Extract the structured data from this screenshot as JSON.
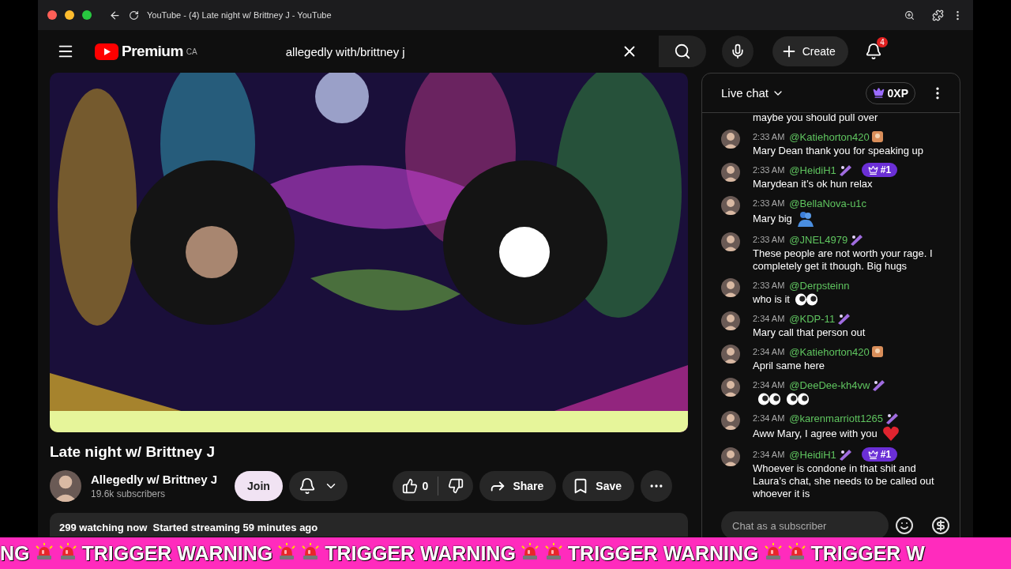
{
  "browser": {
    "tab_title": "YouTube - (4) Late night w/ Brittney J - YouTube"
  },
  "header": {
    "logo": "Premium",
    "region": "CA",
    "search": {
      "value": "allegedly with/brittney j"
    },
    "create": "Create",
    "notifications": "4"
  },
  "video": {
    "kind": "picture",
    "title": "Late night w/ Brittney J",
    "channel": "Allegedly w/ Brittney J",
    "subscribers": "19.6k subscribers",
    "join": "Join",
    "likes": "0",
    "share": "Share",
    "save": "Save",
    "description": "299 watching now  Started streaming 59 minutes ago"
  },
  "chat": {
    "title": "Live chat",
    "xp": "0XP",
    "messages": [
      {
        "kind": "tail",
        "text": "maybe you should pull over"
      },
      {
        "kind": "message",
        "time": "2:33 AM",
        "author": "@Katiehorton420",
        "badge": {
          "kind": "tile"
        },
        "text": "Mary Dean thank you for speaking up"
      },
      {
        "kind": "message",
        "time": "2:33 AM",
        "author": "@HeidiH1",
        "badge": {
          "kind": "sparkle"
        },
        "rank": "#1",
        "text": "Marydean it’s ok hun relax"
      },
      {
        "kind": "message",
        "time": "2:33 AM",
        "author": "@BellaNova-u1c",
        "text": "Mary big",
        "icons": [
          {
            "kind": "hug"
          }
        ]
      },
      {
        "kind": "message",
        "time": "2:33 AM",
        "author": "@JNEL4979",
        "badge": {
          "kind": "sparkle"
        },
        "text": "These people are not worth your rage. I completely get it though. Big hugs"
      },
      {
        "kind": "message",
        "time": "2:33 AM",
        "author": "@Derpsteinn",
        "text": "who is it",
        "icons": [
          {
            "kind": "eyes"
          }
        ]
      },
      {
        "kind": "message",
        "time": "2:34 AM",
        "author": "@KDP-11",
        "badge": {
          "kind": "sparkle"
        },
        "text": "Mary call that person out"
      },
      {
        "kind": "message",
        "time": "2:34 AM",
        "author": "@Katiehorton420",
        "badge": {
          "kind": "tile"
        },
        "text": "April same here"
      },
      {
        "kind": "message",
        "time": "2:34 AM",
        "author": "@DeeDee-kh4vw",
        "badge": {
          "kind": "sparkle"
        },
        "icons": [
          {
            "kind": "eyes"
          },
          {
            "kind": "eyes"
          }
        ]
      },
      {
        "kind": "message",
        "time": "2:34 AM",
        "author": "@karenmarriott1265",
        "badge": {
          "kind": "sparkle"
        },
        "text": "Aww Mary, I agree with you",
        "icons": [
          {
            "kind": "heart"
          }
        ]
      },
      {
        "kind": "message",
        "time": "2:34 AM",
        "author": "@HeidiH1",
        "badge": {
          "kind": "sparkle"
        },
        "rank": "#1",
        "text": "Whoever is condone in that shit and Laura’s chat, she needs to be called out whoever it is"
      }
    ],
    "input": {
      "placeholder": "Chat as a subscriber"
    }
  },
  "banner": {
    "segments": [
      "NG",
      "TRIGGER WARNING",
      "TRIGGER WARNING",
      "TRIGGER WARNING",
      "TRIGGER W"
    ]
  }
}
